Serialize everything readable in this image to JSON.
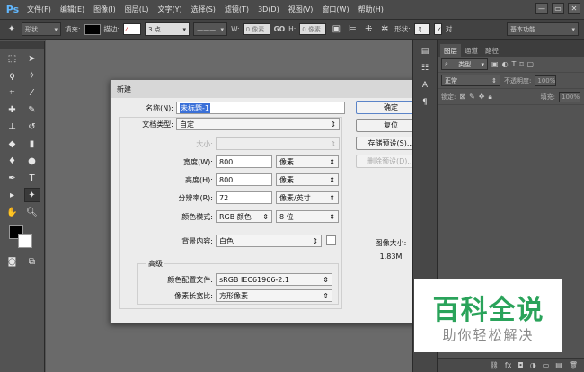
{
  "app": {
    "logo": "Ps"
  },
  "menu": [
    "文件(F)",
    "编辑(E)",
    "图像(I)",
    "图层(L)",
    "文字(Y)",
    "选择(S)",
    "滤镜(T)",
    "3D(D)",
    "视图(V)",
    "窗口(W)",
    "帮助(H)"
  ],
  "window_controls": {
    "minimize": "—",
    "restore": "▭",
    "close": "✕"
  },
  "options_bar": {
    "mode_value": "形状",
    "fill_label": "填充:",
    "stroke_label": "描边:",
    "stroke_width": "3 点",
    "w_label": "W:",
    "w_value": "0 像素",
    "link": "GO",
    "h_label": "H:",
    "h_value": "0 像素",
    "shape_label": "形状:",
    "align_label": "对",
    "workspace": "基本功能"
  },
  "dialog": {
    "title": "新建",
    "close": "✕",
    "name_label": "名称(N):",
    "name_value": "未标题-1",
    "preset_label": "文档类型:",
    "preset_value": "自定",
    "size_label": "大小:",
    "size_value": "",
    "width_label": "宽度(W):",
    "width_value": "800",
    "width_unit": "像素",
    "height_label": "高度(H):",
    "height_value": "800",
    "height_unit": "像素",
    "resolution_label": "分辨率(R):",
    "resolution_value": "72",
    "resolution_unit": "像素/英寸",
    "color_mode_label": "颜色模式:",
    "color_mode_value": "RGB 颜色",
    "bit_depth": "8 位",
    "bg_label": "背景内容:",
    "bg_value": "白色",
    "advanced_label": "高级",
    "profile_label": "颜色配置文件:",
    "profile_value": "sRGB IEC61966-2.1",
    "pixel_aspect_label": "像素长宽比:",
    "pixel_aspect_value": "方形像素",
    "ok_button": "确定",
    "reset_button": "复位",
    "save_preset_button": "存储预设(S)...",
    "delete_preset_button": "删除预设(D)...",
    "image_size_label": "图像大小:",
    "image_size_value": "1.83M"
  },
  "panel": {
    "tabs": [
      "图层",
      "通道",
      "路径"
    ],
    "kind_filter": "类型",
    "blend_mode": "正常",
    "opacity_label": "不透明度:",
    "opacity_value": "100%",
    "lock_label": "锁定:",
    "fill_label": "填充:",
    "fill_value": "100%"
  },
  "watermark": {
    "main": "百科全说",
    "sub": "助你轻松解决"
  }
}
